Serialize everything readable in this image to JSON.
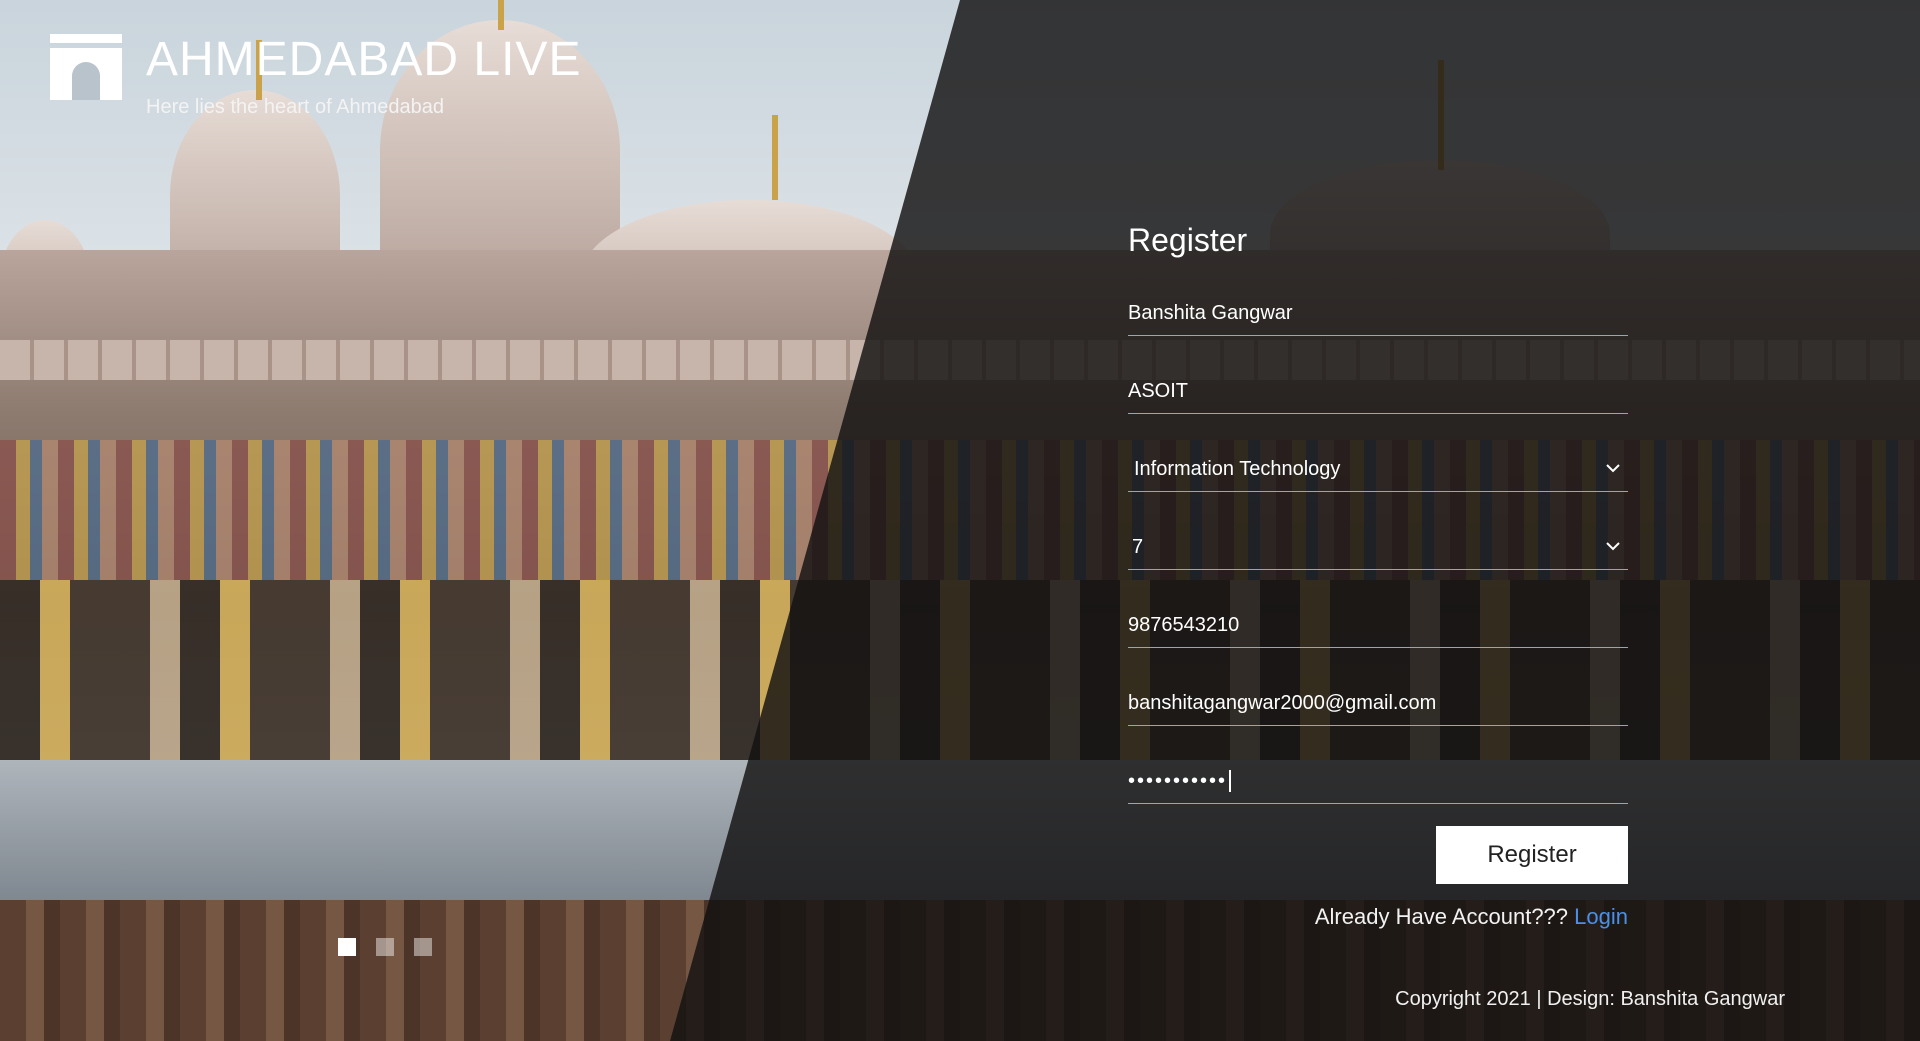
{
  "brand": {
    "title": "AHMEDABAD LIVE",
    "subtitle": "Here lies the heart of Ahmedabad",
    "logo_icon": "arch-gate-icon"
  },
  "form": {
    "title": "Register",
    "name_value": "Banshita Gangwar",
    "college_value": "ASOIT",
    "department_value": "Information Technology",
    "semester_value": "7",
    "phone_value": "9876543210",
    "email_value": "banshitagangwar2000@gmail.com",
    "password_masked": "•••••••••••",
    "submit_label": "Register",
    "login_prompt": "Already Have Account???",
    "login_link": "Login"
  },
  "slider": {
    "dot_count": 3,
    "active_index": 0
  },
  "footer": {
    "copyright": "Copyright 2021 | Design: Banshita Gangwar"
  },
  "colors": {
    "link": "#4b8fe8",
    "button_bg": "#ffffff",
    "overlay": "#121111"
  }
}
